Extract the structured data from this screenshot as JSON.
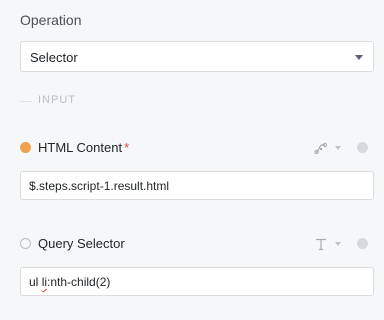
{
  "operation": {
    "label": "Operation",
    "selected": "Selector"
  },
  "input_section": {
    "label": "INPUT"
  },
  "fields": {
    "html_content": {
      "label": "HTML Content",
      "required_marker": "*",
      "value": "$.steps.script-1.result.html",
      "type_icon": "connector-icon"
    },
    "query_selector": {
      "label": "Query Selector",
      "value_prefix": "ul ",
      "value_misspelled": "li",
      "value_suffix": ":nth-child(2)",
      "type_icon": "text-type-icon"
    }
  },
  "colors": {
    "required_dot": "#f0a14f",
    "required_star": "#e0474c",
    "border": "#d9dce1",
    "background": "#f6f7f9"
  }
}
